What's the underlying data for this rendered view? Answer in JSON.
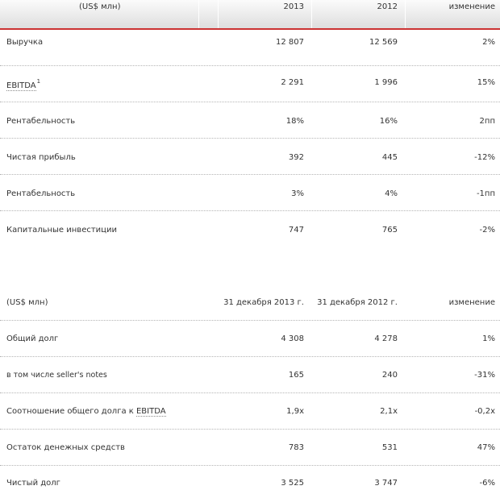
{
  "table1": {
    "header": {
      "label": "(US$ млн)",
      "col1": "2013",
      "col2": "2012",
      "col3": "изменение"
    },
    "rows": [
      {
        "label": "Выручка",
        "col1": "12 807",
        "col2": "12 569",
        "col3": "2%"
      },
      {
        "label": "EBITDA",
        "footnote": "1",
        "col1": "2 291",
        "col2": "1 996",
        "col3": "15%"
      },
      {
        "label": "Рентабельность",
        "col1": "18%",
        "col2": "16%",
        "col3": "2пп"
      },
      {
        "label": "Чистая прибыль",
        "col1": "392",
        "col2": "445",
        "col3": "-12%"
      },
      {
        "label": "Рентабельность",
        "col1": "3%",
        "col2": "4%",
        "col3": "-1пп"
      },
      {
        "label": "Капитальные инвестиции",
        "col1": "747",
        "col2": "765",
        "col3": "-2%"
      }
    ]
  },
  "table2": {
    "header": {
      "label": "(US$ млн)",
      "col1": "31 декабря 2013 г.",
      "col2": "31 декабря 2012 г.",
      "col3": "изменение"
    },
    "rows": [
      {
        "label": "Общий долг",
        "col1": "4 308",
        "col2": "4 278",
        "col3": "1%"
      },
      {
        "label": "в том числе seller's notes",
        "col1": "165",
        "col2": "240",
        "col3": "-31%"
      },
      {
        "label_prefix": "Соотношение общего долга к ",
        "label_abbr": "EBITDA",
        "col1": "1,9x",
        "col2": "2,1x",
        "col3": "-0,2x"
      },
      {
        "label": "Остаток денежных средств",
        "col1": "783",
        "col2": "531",
        "col3": "47%"
      },
      {
        "label": "Чистый долг",
        "col1": "3 525",
        "col2": "3 747",
        "col3": "-6%"
      }
    ]
  },
  "colors": {
    "header_rule": "#cc3333",
    "dotted_rule": "#b5b5b5",
    "text": "#333333"
  }
}
